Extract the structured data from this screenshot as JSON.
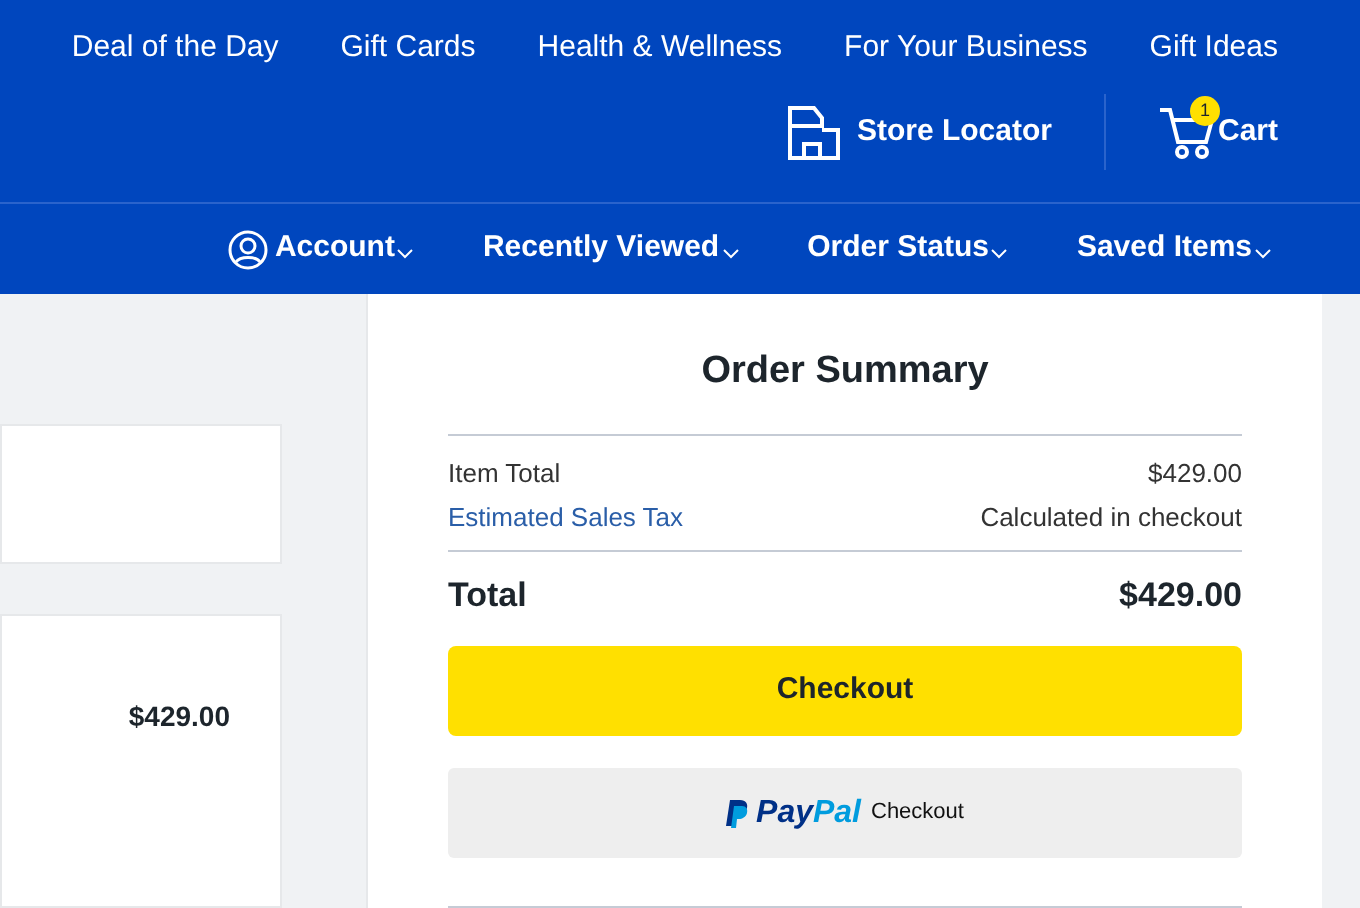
{
  "top_links": [
    "Deal of the Day",
    "Gift Cards",
    "Health & Wellness",
    "For Your Business",
    "Gift Ideas"
  ],
  "store_locator": "Store Locator",
  "cart": {
    "label": "Cart",
    "count": "1"
  },
  "nav": [
    "Account",
    "Recently Viewed",
    "Order Status",
    "Saved Items"
  ],
  "item": {
    "price": "$429.00"
  },
  "summary": {
    "title": "Order Summary",
    "lines": [
      {
        "label": "Item Total",
        "value": "$429.00",
        "kind": "plain"
      },
      {
        "label": "Estimated Sales Tax",
        "value": "Calculated in checkout",
        "kind": "link"
      }
    ],
    "total": {
      "label": "Total",
      "value": "$429.00"
    },
    "checkout": "Checkout",
    "paypal": {
      "first": "Pay",
      "second": "Pal",
      "label": "Checkout"
    }
  }
}
